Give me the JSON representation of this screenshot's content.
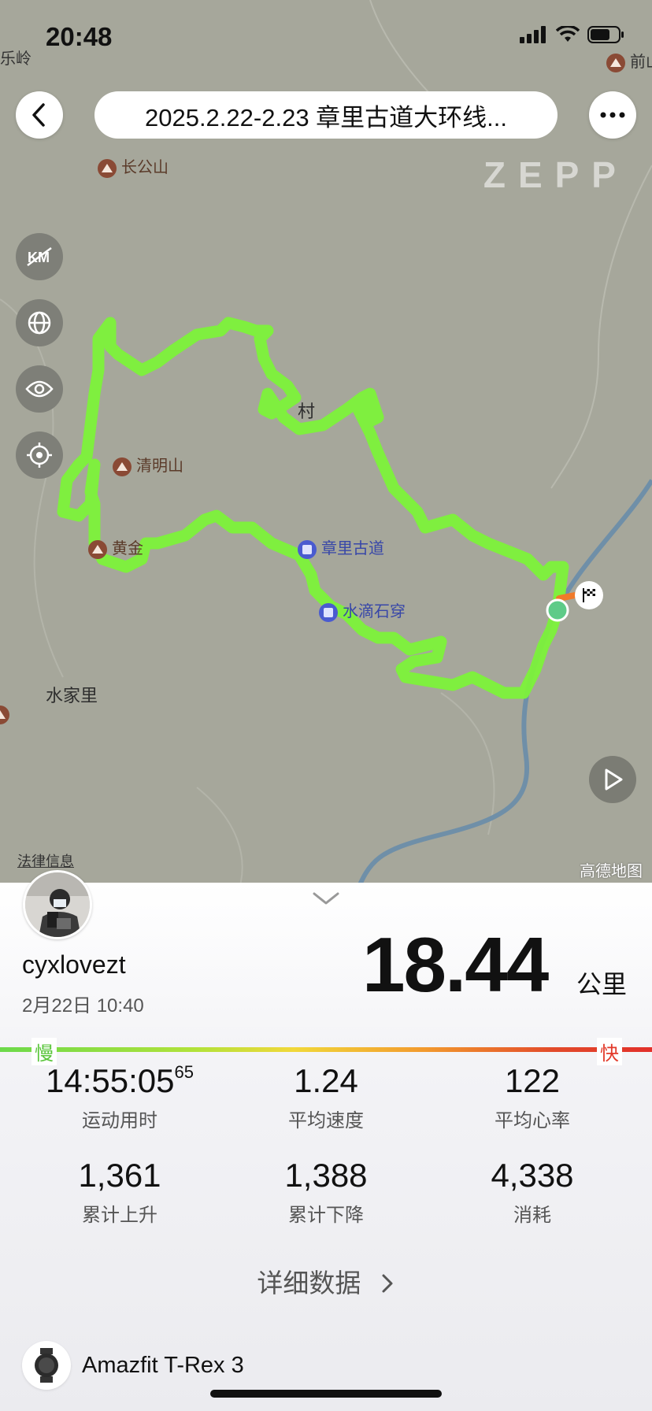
{
  "status": {
    "time": "20:48"
  },
  "header": {
    "title": "2025.2.22-2.23 章里古道大环线..."
  },
  "brand": "ZEPP",
  "map": {
    "labels": {
      "leling": "乐岭",
      "qianshan": "前山",
      "changgongshan": "长公山",
      "cun": "村",
      "qingmingshan": "清明山",
      "huangjin": "黄金",
      "zhangli_gudao": "章里古道",
      "shuidi_shichuan": "水滴石穿",
      "shuijiali": "水家里"
    },
    "legal": "法律信息",
    "provider": "高德地图",
    "route_color": "#7cf23a"
  },
  "side_icons": [
    "km-off-icon",
    "globe-icon",
    "eye-icon",
    "locate-icon"
  ],
  "summary": {
    "username": "cyxlovezt",
    "datetime": "2月22日 10:40",
    "distance": "18.44",
    "distance_unit": "公里",
    "slow": "慢",
    "fast": "快"
  },
  "stats": [
    {
      "value": "14:55:05",
      "suffix": "65",
      "label": "运动用时"
    },
    {
      "value": "1.24",
      "label": "平均速度"
    },
    {
      "value": "122",
      "label": "平均心率"
    },
    {
      "value": "1,361",
      "label": "累计上升"
    },
    {
      "value": "1,388",
      "label": "累计下降"
    },
    {
      "value": "4,338",
      "label": "消耗"
    }
  ],
  "detail_link": "详细数据",
  "device": {
    "name": "Amazfit T-Rex 3"
  }
}
